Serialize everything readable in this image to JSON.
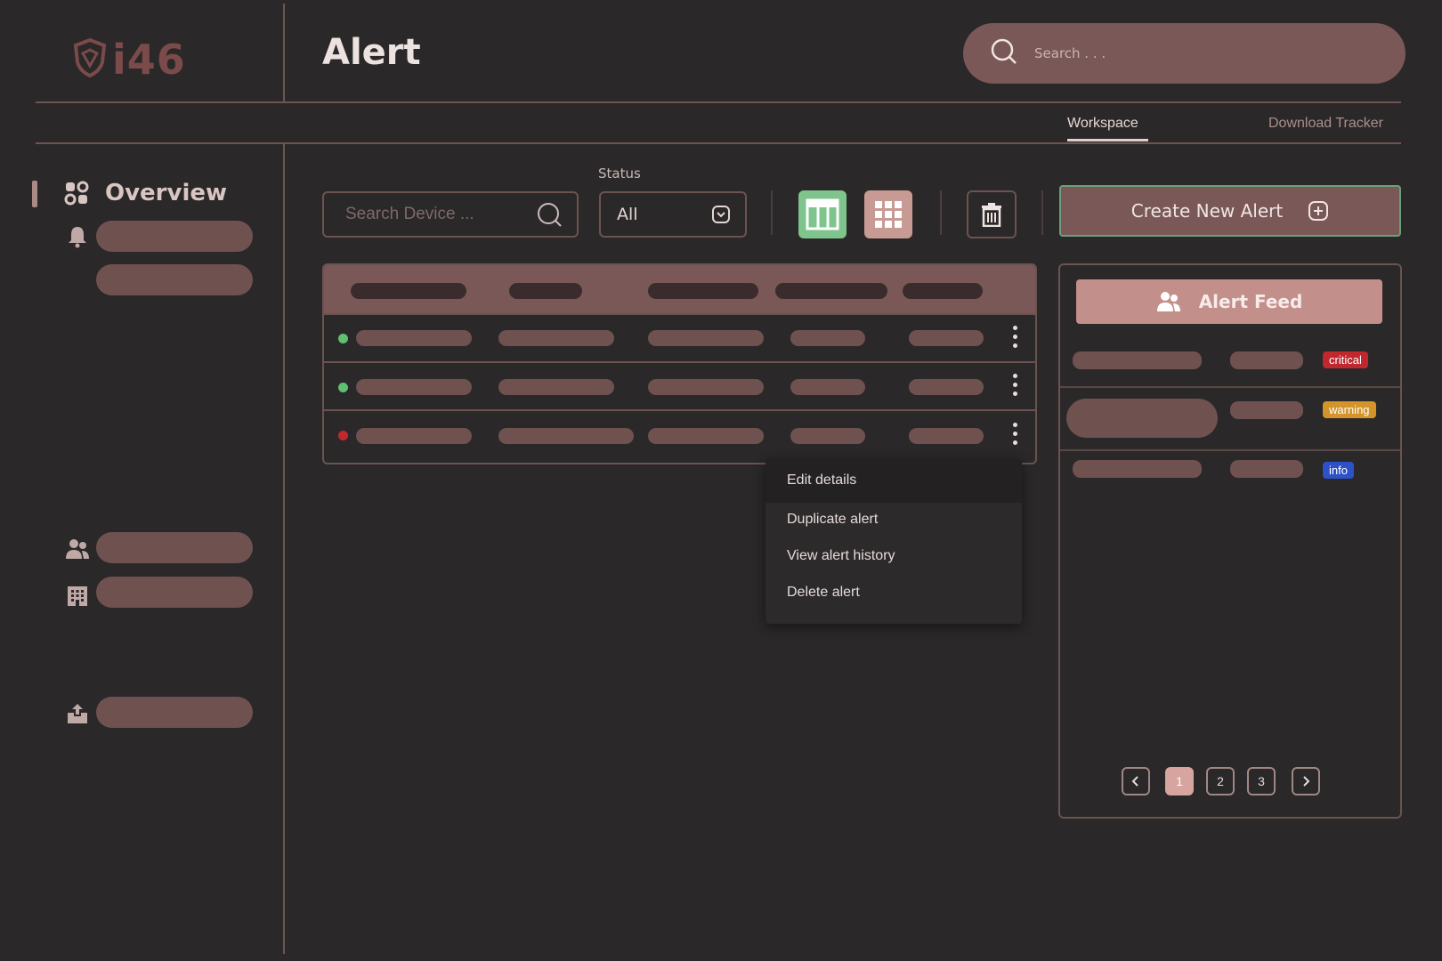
{
  "app": {
    "logo_text": "i46",
    "page_title": "Alert"
  },
  "header": {
    "search_placeholder": "Search . . ."
  },
  "tabs": [
    {
      "label": "Workspace",
      "active": true
    },
    {
      "label": "Download Tracker",
      "active": false
    }
  ],
  "sidebar": {
    "overview_label": "Overview"
  },
  "toolbar": {
    "search_device_placeholder": "Search Device ...",
    "status_label": "Status",
    "status_value": "All",
    "create_label": "Create New Alert"
  },
  "table": {
    "row_status_colors": [
      "#5fbf72",
      "#5fbf72",
      "#c0282e"
    ]
  },
  "context_menu": {
    "items": [
      "Edit details",
      "Duplicate alert",
      "View alert history",
      "Delete alert"
    ]
  },
  "feed": {
    "title": "Alert Feed",
    "badges": [
      "critical",
      "warning",
      "info"
    ],
    "pages": [
      "1",
      "2",
      "3"
    ],
    "active_page": "1"
  },
  "colors": {
    "accent": "#7a5857",
    "background": "#2a2829",
    "critical": "#c0282e",
    "warning": "#d3942a",
    "info": "#2d51c7",
    "success": "#5fbf72"
  }
}
